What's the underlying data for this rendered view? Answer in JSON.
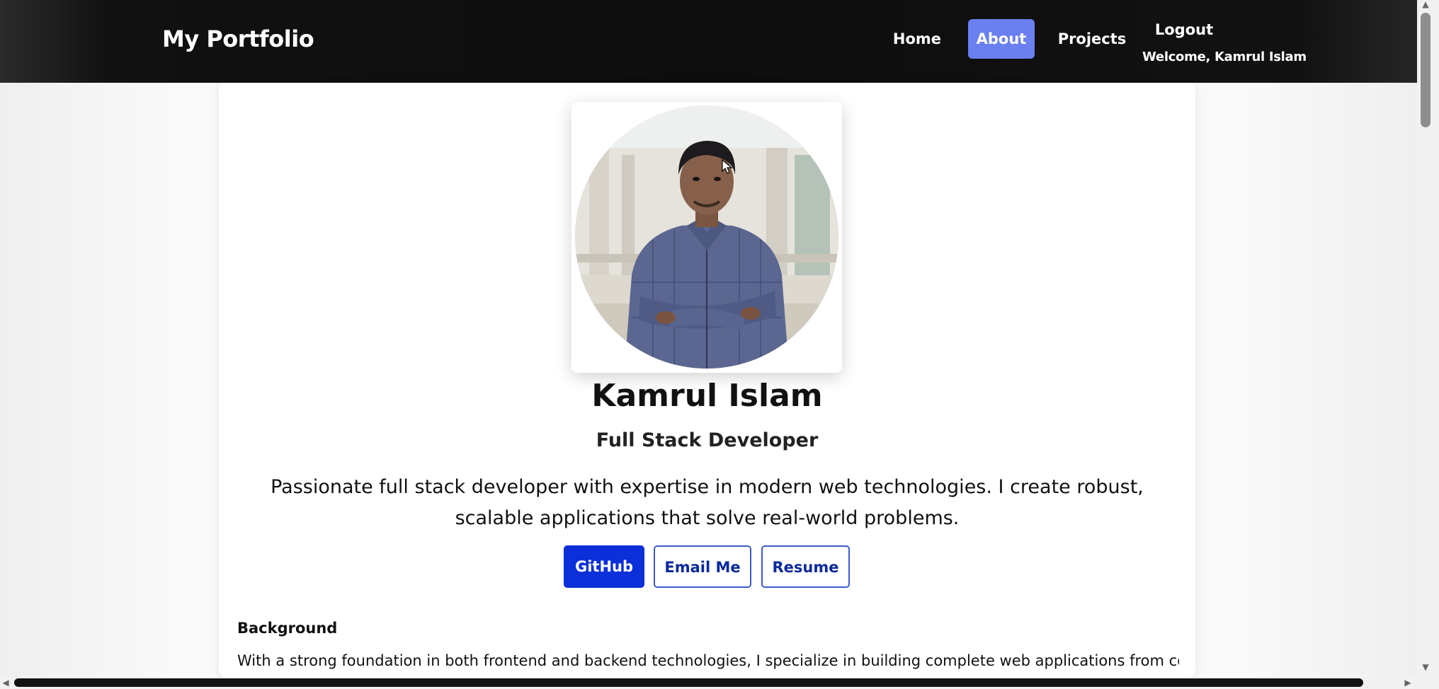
{
  "navbar": {
    "brand": "My Portfolio",
    "links": [
      {
        "label": "Home",
        "active": false
      },
      {
        "label": "About",
        "active": true
      },
      {
        "label": "Projects",
        "active": false
      }
    ],
    "logout_label": "Logout",
    "welcome_text": "Welcome, Kamrul Islam",
    "active_color": "#6a7ff0"
  },
  "profile": {
    "name": "Kamrul Islam",
    "role": "Full Stack Developer",
    "bio": "Passionate full stack developer with expertise in modern web technologies. I create robust, scalable applications that solve real-world problems."
  },
  "actions": {
    "github_label": "GitHub",
    "email_label": "Email Me",
    "resume_label": "Resume",
    "primary_color": "#0b2fd8"
  },
  "background_section": {
    "title": "Background",
    "text": "With a strong foundation in both frontend and backend technologies, I specialize in building complete web applications from concept to"
  }
}
